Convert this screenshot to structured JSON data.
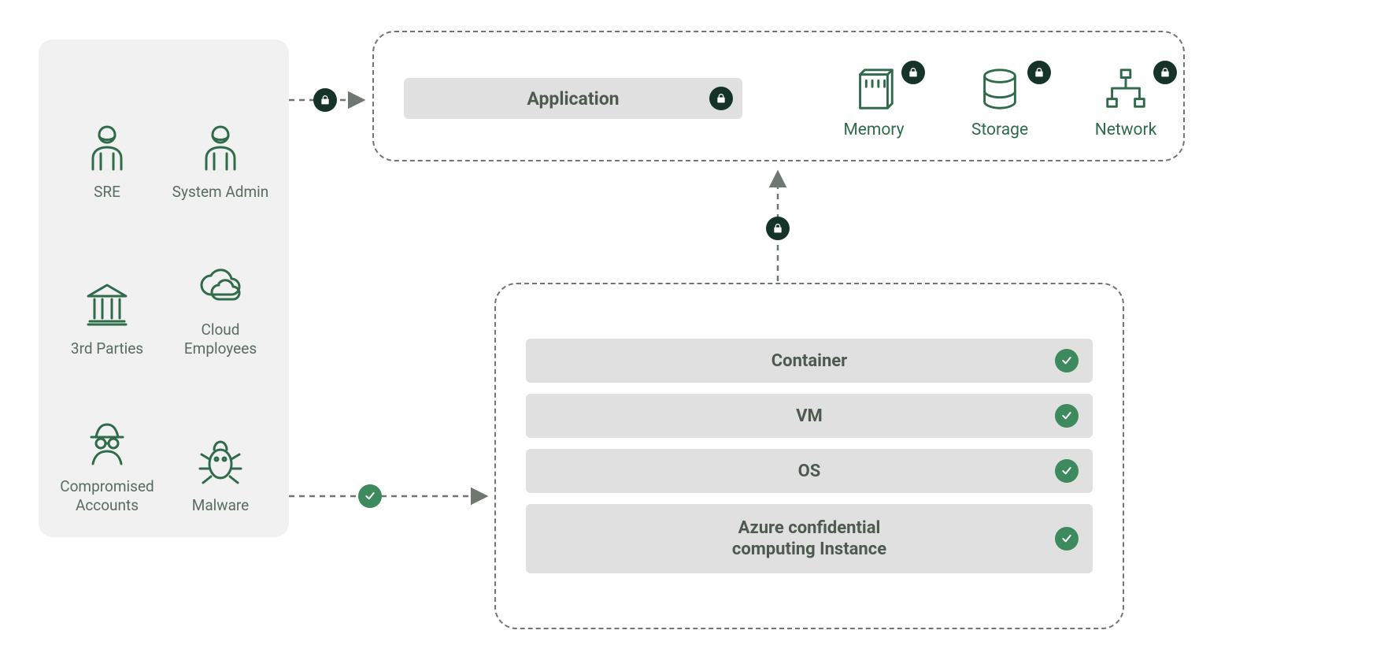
{
  "threats": {
    "items": [
      {
        "name": "sre",
        "label": "SRE",
        "icon": "person"
      },
      {
        "name": "system-admin",
        "label": "System\nAdmin",
        "icon": "person"
      },
      {
        "name": "third-parties",
        "label": "3rd\nParties",
        "icon": "bank"
      },
      {
        "name": "cloud-employees",
        "label": "Cloud\nEmployees",
        "icon": "cloud"
      },
      {
        "name": "compromised-accounts",
        "label": "Compromised\nAccounts",
        "icon": "spy"
      },
      {
        "name": "malware",
        "label": "Malware",
        "icon": "bug"
      }
    ]
  },
  "application": {
    "label": "Application"
  },
  "resources": {
    "memory": {
      "label": "Memory"
    },
    "storage": {
      "label": "Storage"
    },
    "network": {
      "label": "Network"
    }
  },
  "stack": {
    "items": [
      {
        "name": "container",
        "label": "Container"
      },
      {
        "name": "vm",
        "label": "VM"
      },
      {
        "name": "os",
        "label": "OS"
      },
      {
        "name": "instance",
        "label": "Azure confidential\ncomputing Instance",
        "large": true
      }
    ]
  }
}
